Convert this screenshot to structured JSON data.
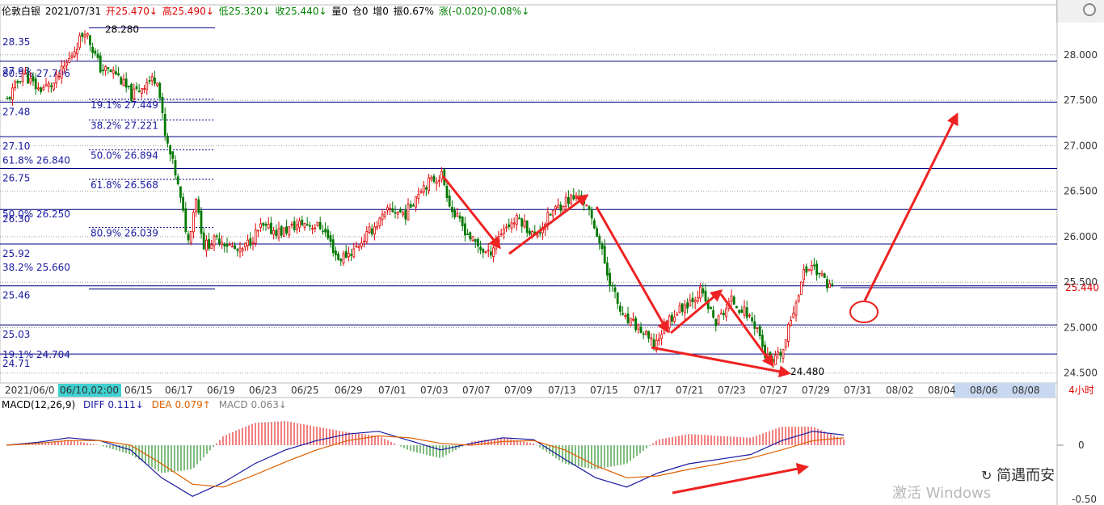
{
  "header": {
    "instrument": "伦敦白银",
    "date": "2021/07/31",
    "open": "开25.470↓",
    "high": "高25.490↓",
    "low": "低25.320↓",
    "close": "收25.440↓",
    "volume": "量0",
    "position": "仓0",
    "increase": "增0",
    "amplitude": "振0.67%",
    "change": "涨(-0.020)-0.08%↓"
  },
  "period_button": "4小时",
  "macd": {
    "title": "MACD(12,26,9)",
    "diff": "DIFF 0.111↓",
    "dea": "DEA 0.079↑",
    "macd": "MACD 0.063↓",
    "axis_labels": [
      "0",
      "-0.50"
    ]
  },
  "watermark": "简遇而安",
  "activate_text": "激活 Windows",
  "colors": {
    "up": "#e00000",
    "down": "#007800",
    "level_line": "#000080",
    "label_blue": "#1a1aa0",
    "arrow": "#ee2222",
    "diff_line": "#1a1aa0",
    "dea_line": "#e06000",
    "highlight_bg": "#40d0d0"
  },
  "chart_data": {
    "type": "candlestick",
    "title": "",
    "timeframe": "4小时",
    "ylim": [
      24.4,
      28.55
    ],
    "y_ticks": [
      24.5,
      25.0,
      25.5,
      26.0,
      26.5,
      27.0,
      27.5,
      28.0
    ],
    "y_tick_labels": [
      "24.500",
      "25.000",
      "25.500",
      "26.000",
      "26.500",
      "27.000",
      "27.500",
      "28.000"
    ],
    "x_labels": [
      "2021/06/0",
      "06/10,02:00",
      "06/15",
      "06/17",
      "06/19",
      "06/23",
      "06/25",
      "06/29",
      "07/01",
      "07/03",
      "07/07",
      "07/09",
      "07/13",
      "07/15",
      "07/17",
      "07/21",
      "07/23",
      "07/27",
      "07/29",
      "07/31",
      "08/02",
      "08/04",
      "08/06",
      "08/08"
    ],
    "x_highlight_label": "06/10,02:00",
    "current_price": 25.44,
    "current_price_label": "25.440",
    "high_annotation": {
      "label": "28.280",
      "value": 28.28
    },
    "low_annotation": {
      "label": "24.480",
      "value": 24.48
    },
    "horizontal_levels": [
      {
        "label": "28.35",
        "value": 27.93
      },
      {
        "label": "27.93",
        "value": 27.93
      },
      {
        "label": "27.48",
        "value": 27.48
      },
      {
        "label": "27.10",
        "value": 27.1
      },
      {
        "label": "26.75",
        "value": 26.75
      },
      {
        "label": "26.30",
        "value": 26.3
      },
      {
        "label": "25.92",
        "value": 25.92
      },
      {
        "label": "25.46",
        "value": 25.46
      },
      {
        "label": "25.03",
        "value": 25.03
      },
      {
        "label": "24.71",
        "value": 24.71
      }
    ],
    "fib_left": [
      {
        "label": "80.9% 27.796",
        "value": 27.796
      },
      {
        "label": "61.8% 26.840",
        "value": 26.84
      },
      {
        "label": "50.0% 26.250",
        "value": 26.25
      },
      {
        "label": "38.2% 25.660",
        "value": 25.66
      },
      {
        "label": "19.1% 24.704",
        "value": 24.704
      }
    ],
    "fib_inner": [
      {
        "label": "19.1% 27.449",
        "value": 27.449
      },
      {
        "label": "38.2% 27.221",
        "value": 27.221
      },
      {
        "label": "50.0% 26.894",
        "value": 26.894
      },
      {
        "label": "61.8% 26.568",
        "value": 26.568
      },
      {
        "label": "80.9% 26.039",
        "value": 26.039
      }
    ],
    "price_path": [
      {
        "i": 0,
        "v": 27.5
      },
      {
        "i": 6,
        "v": 27.8
      },
      {
        "i": 12,
        "v": 27.62
      },
      {
        "i": 18,
        "v": 27.68
      },
      {
        "i": 24,
        "v": 27.95
      },
      {
        "i": 30,
        "v": 28.28
      },
      {
        "i": 36,
        "v": 27.85
      },
      {
        "i": 42,
        "v": 27.8
      },
      {
        "i": 48,
        "v": 27.55
      },
      {
        "i": 54,
        "v": 27.7
      },
      {
        "i": 58,
        "v": 27.75
      },
      {
        "i": 61,
        "v": 27.1
      },
      {
        "i": 65,
        "v": 26.7
      },
      {
        "i": 70,
        "v": 25.95
      },
      {
        "i": 73,
        "v": 26.45
      },
      {
        "i": 76,
        "v": 25.9
      },
      {
        "i": 82,
        "v": 25.98
      },
      {
        "i": 90,
        "v": 25.82
      },
      {
        "i": 98,
        "v": 26.1
      },
      {
        "i": 106,
        "v": 26.05
      },
      {
        "i": 114,
        "v": 26.15
      },
      {
        "i": 122,
        "v": 26.1
      },
      {
        "i": 128,
        "v": 25.75
      },
      {
        "i": 134,
        "v": 25.85
      },
      {
        "i": 140,
        "v": 26.05
      },
      {
        "i": 148,
        "v": 26.3
      },
      {
        "i": 154,
        "v": 26.25
      },
      {
        "i": 160,
        "v": 26.55
      },
      {
        "i": 168,
        "v": 26.68
      },
      {
        "i": 172,
        "v": 26.28
      },
      {
        "i": 180,
        "v": 25.95
      },
      {
        "i": 186,
        "v": 25.8
      },
      {
        "i": 192,
        "v": 26.1
      },
      {
        "i": 198,
        "v": 26.2
      },
      {
        "i": 204,
        "v": 26.0
      },
      {
        "i": 210,
        "v": 26.25
      },
      {
        "i": 216,
        "v": 26.4
      },
      {
        "i": 222,
        "v": 26.45
      },
      {
        "i": 228,
        "v": 26.05
      },
      {
        "i": 232,
        "v": 25.6
      },
      {
        "i": 238,
        "v": 25.1
      },
      {
        "i": 244,
        "v": 25.0
      },
      {
        "i": 250,
        "v": 24.8
      },
      {
        "i": 256,
        "v": 25.1
      },
      {
        "i": 262,
        "v": 25.25
      },
      {
        "i": 268,
        "v": 25.4
      },
      {
        "i": 274,
        "v": 25.05
      },
      {
        "i": 280,
        "v": 25.3
      },
      {
        "i": 286,
        "v": 25.15
      },
      {
        "i": 290,
        "v": 25.0
      },
      {
        "i": 293,
        "v": 24.7
      },
      {
        "i": 296,
        "v": 24.6
      },
      {
        "i": 300,
        "v": 24.75
      },
      {
        "i": 304,
        "v": 25.2
      },
      {
        "i": 308,
        "v": 25.6
      },
      {
        "i": 311,
        "v": 25.7
      },
      {
        "i": 315,
        "v": 25.55
      },
      {
        "i": 319,
        "v": 25.44
      }
    ],
    "series": [
      {
        "name": "DIFF",
        "values": [
          0.0,
          0.03,
          0.08,
          0.05,
          -0.05,
          -0.35,
          -0.55,
          -0.4,
          -0.2,
          -0.05,
          0.05,
          0.12,
          0.15,
          0.05,
          -0.05,
          0.02,
          0.08,
          0.06,
          -0.15,
          -0.35,
          -0.45,
          -0.3,
          -0.2,
          -0.15,
          -0.1,
          0.05,
          0.15,
          0.11
        ]
      },
      {
        "name": "DEA",
        "values": [
          0.0,
          0.02,
          0.05,
          0.05,
          0.0,
          -0.2,
          -0.42,
          -0.45,
          -0.32,
          -0.18,
          -0.05,
          0.05,
          0.1,
          0.08,
          0.02,
          0.0,
          0.04,
          0.05,
          -0.05,
          -0.22,
          -0.35,
          -0.33,
          -0.26,
          -0.2,
          -0.14,
          -0.05,
          0.05,
          0.079
        ]
      },
      {
        "name": "MACD",
        "values": [
          0.0,
          0.02,
          0.06,
          0.0,
          -0.1,
          -0.3,
          -0.26,
          0.1,
          0.24,
          0.26,
          0.2,
          0.14,
          0.1,
          -0.06,
          -0.14,
          0.04,
          0.08,
          0.02,
          -0.2,
          -0.26,
          -0.2,
          0.06,
          0.12,
          0.1,
          0.08,
          0.2,
          0.2,
          0.063
        ]
      }
    ]
  }
}
